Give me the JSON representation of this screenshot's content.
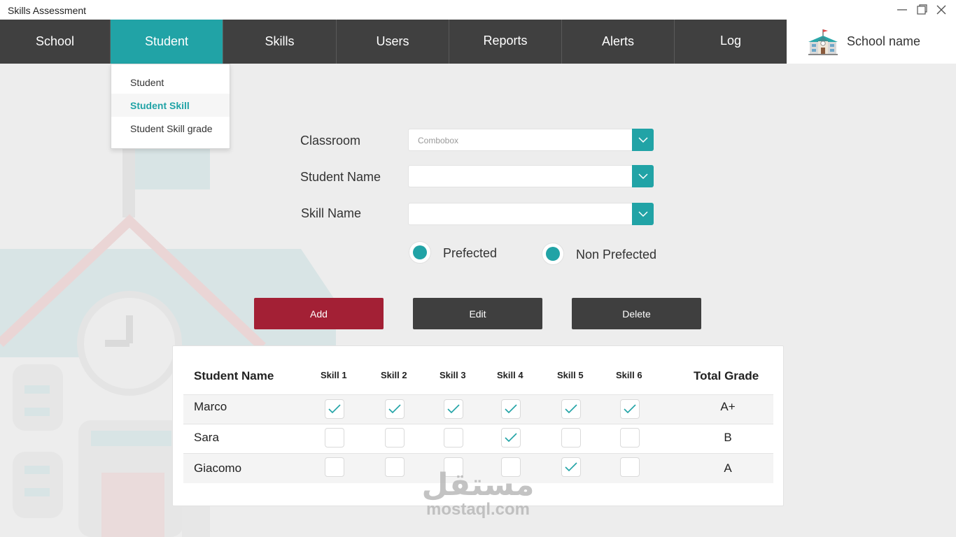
{
  "window": {
    "title": "Skills Assessment",
    "controls": [
      "minimize-icon",
      "maximize-icon",
      "close-icon"
    ]
  },
  "nav": {
    "items": [
      "School",
      "Student",
      "Skills",
      "Users",
      "Reports",
      "Alerts",
      "Log"
    ],
    "active": "Student",
    "school_name": "School name",
    "school_icon": "school-building-icon"
  },
  "dropdown": {
    "items": [
      "Student",
      "Student Skill",
      "Student Skill grade"
    ],
    "active": "Student Skill"
  },
  "form": {
    "classroom_label": "Classroom",
    "classroom_placeholder": "Combobox",
    "student_name_label": "Student Name",
    "skill_name_label": "Skill Name",
    "radio_prefected": "Prefected",
    "radio_non_prefected": "Non Prefected"
  },
  "buttons": {
    "add": "Add",
    "edit": "Edit",
    "delete": "Delete"
  },
  "table": {
    "headers": [
      "Student Name",
      "Skill 1",
      "Skill 2",
      "Skill 3",
      "Skill 4",
      "Skill 5",
      "Skill 6",
      "Total Grade"
    ],
    "rows": [
      {
        "name": "Marco",
        "skills": [
          true,
          true,
          true,
          true,
          true,
          true
        ],
        "grade": "A+"
      },
      {
        "name": "Sara",
        "skills": [
          false,
          false,
          false,
          true,
          false,
          false
        ],
        "grade": "B"
      },
      {
        "name": "Giacomo",
        "skills": [
          false,
          false,
          false,
          false,
          true,
          false
        ],
        "grade": "A"
      }
    ]
  },
  "watermark": {
    "arabic": "مستقل",
    "latin": "mostaql.com"
  },
  "colors": {
    "accent": "#21a3a6",
    "nav_bg": "#404040",
    "add_button": "#a32035",
    "dark_button": "#3f3f3f",
    "page_bg": "#ededed"
  }
}
